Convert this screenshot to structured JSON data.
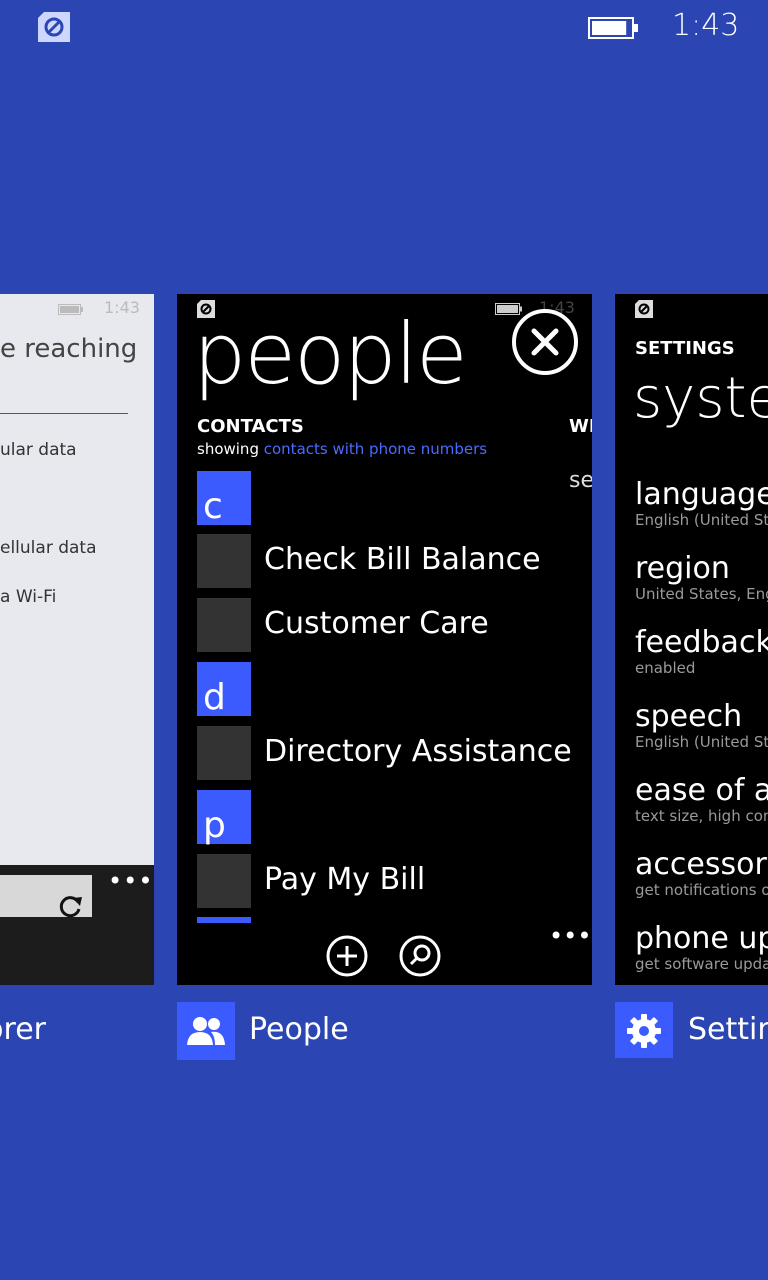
{
  "status_bar": {
    "time": "1:43",
    "battery_level": 0.9
  },
  "cards": {
    "ie": {
      "label": "Internet Explorer",
      "title_fragment": "e reaching",
      "mini_time": "1:43",
      "rows": [
        "ular data",
        "ellular data",
        "a Wi-Fi"
      ],
      "more": "•••"
    },
    "people": {
      "label": "People",
      "title": "people",
      "mini_time": "1:43",
      "pivot_current": "CONTACTS",
      "pivot_next": "WH",
      "showing_prefix": "showing",
      "showing_filter": "contacts with phone numbers",
      "next_pivot_fragment": "se",
      "groups": [
        {
          "letter": "c",
          "contacts": [
            "Check Bill Balance",
            "Customer Care"
          ]
        },
        {
          "letter": "d",
          "contacts": [
            "Directory Assistance"
          ]
        },
        {
          "letter": "p",
          "contacts": [
            "Pay My Bill"
          ]
        }
      ],
      "more": "•••"
    },
    "settings": {
      "label": "Settings",
      "section": "SETTINGS",
      "title": "system",
      "items": [
        {
          "title": "language",
          "sub": "English (United States)"
        },
        {
          "title": "region",
          "sub": "United States, English"
        },
        {
          "title": "feedback",
          "sub": "enabled"
        },
        {
          "title": "speech",
          "sub": "English (United States)"
        },
        {
          "title": "ease of access",
          "sub": "text size, high contrast"
        },
        {
          "title": "accessory apps",
          "sub": "get notifications on accessories"
        },
        {
          "title": "phone update",
          "sub": "get software updates"
        }
      ]
    }
  },
  "colors": {
    "background": "#2b45b3",
    "accent": "#3b5bff",
    "card_dark": "#000000"
  }
}
